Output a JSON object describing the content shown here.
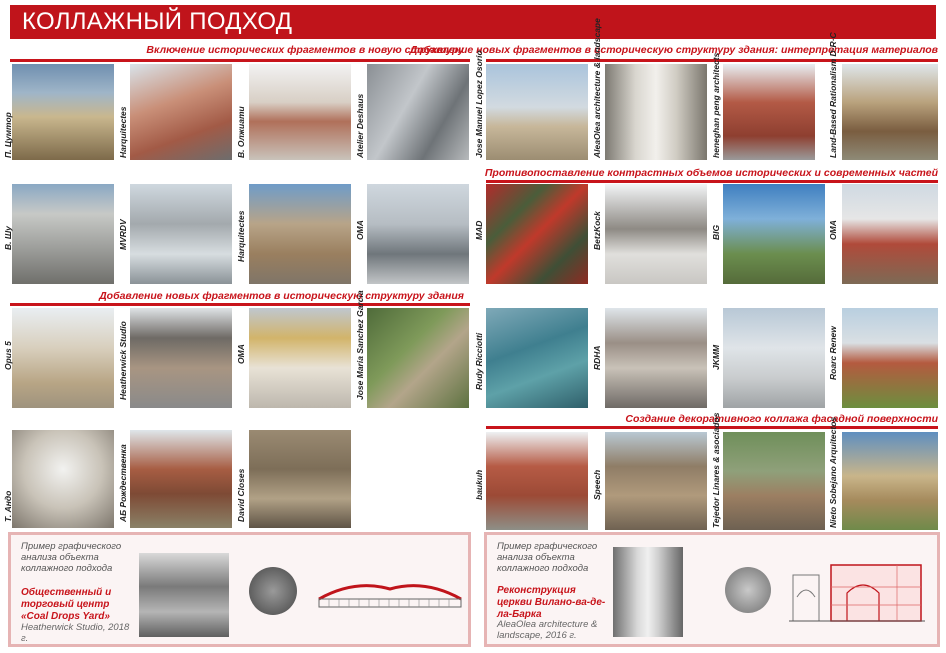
{
  "header": {
    "title": "КОЛЛАЖНЫЙ ПОДХОД"
  },
  "sections": {
    "s1": "Включение исторических фрагментов в новую структуру",
    "s2": "Добавление новых фрагментов в историческую структуру здания: интерпретация материалов",
    "s3": "Противопоставление контрастных объемов исторических и современных частей",
    "s4": "Добавление новых фрагментов в историческую структуру здания",
    "s5": "Создание декоративного коллажа фасадной поверхности"
  },
  "labels": {
    "l1": "П. Цумтор",
    "l2": "Harquitectes",
    "l3": "В. Олжиати",
    "l4": "Atelier Deshaus",
    "l5": "Jose Manuel Lopez Osorio",
    "l6": "AleaOlea architecture & landscape",
    "l7": "heneghan peng architects",
    "l8": "Land-Based Rationalism D·R·C",
    "l9": "В. Шу",
    "l10": "MVRDV",
    "l11": "Harquitectes",
    "l12": "OMA",
    "l13": "MAD",
    "l14": "BetzKock",
    "l15": "BIG",
    "l16": "OMA",
    "l17": "Opus 5",
    "l18": "Heatherwick Studio",
    "l19": "OMA",
    "l20": "Jose Maria Sanchez Garcia",
    "l21": "Rudy Ricciotti",
    "l22": "RDHA",
    "l23": "JKMM",
    "l24": "Roarc Renew",
    "l25": "Т. Андо",
    "l26": "АБ Рождественка",
    "l27": "David Closes",
    "l28": "baukuh",
    "l29": "Speech",
    "l30": "Tejedor Linares & asociados",
    "l31": "Nieto Sobejano Arquitectos"
  },
  "example_left": {
    "title": "Пример графического анализа объекта коллажного подхода",
    "object": "Общественный и торговый центр «Coal Drops Yard»",
    "author": "Heatherwick Studio, 2018 г."
  },
  "example_right": {
    "title": "Пример графического анализа объекта коллажного подхода",
    "object": "Реконструкция церкви Вилано-ва-де-ла-Барка",
    "author": "AleaOlea architecture & landscape, 2016 г."
  },
  "colors": {
    "accent": "#c0141b",
    "note_border": "#e6b4b4"
  }
}
